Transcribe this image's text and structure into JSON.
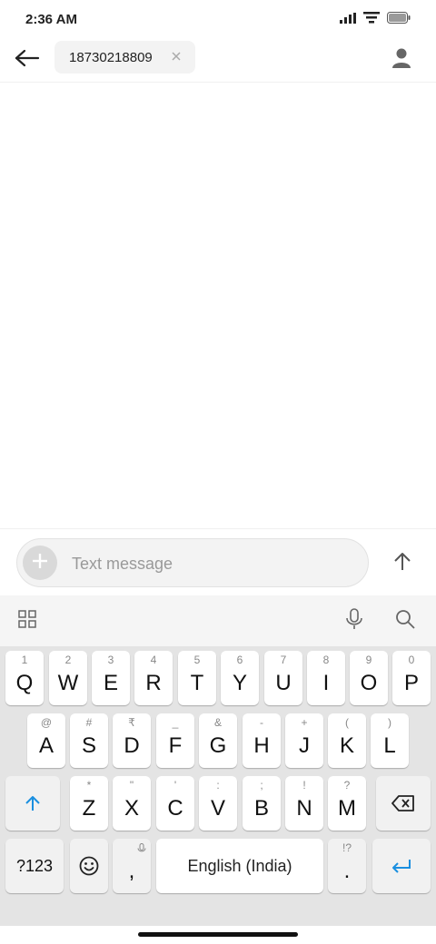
{
  "status_bar": {
    "time": "2:36 AM",
    "icons": [
      "signal-icon",
      "wifi-icon",
      "battery-icon"
    ]
  },
  "header": {
    "recipient": "18730218809",
    "back_icon": "arrow-left-icon",
    "contact_icon": "person-icon"
  },
  "compose": {
    "placeholder": "Text message",
    "add_icon": "plus-icon",
    "send_icon": "arrow-up-icon"
  },
  "keyboard": {
    "toolbar": {
      "left": "grid-icon",
      "right": [
        "mic-icon",
        "search-icon"
      ]
    },
    "row1": [
      {
        "key": "Q",
        "hint": "1"
      },
      {
        "key": "W",
        "hint": "2"
      },
      {
        "key": "E",
        "hint": "3"
      },
      {
        "key": "R",
        "hint": "4"
      },
      {
        "key": "T",
        "hint": "5"
      },
      {
        "key": "Y",
        "hint": "6"
      },
      {
        "key": "U",
        "hint": "7"
      },
      {
        "key": "I",
        "hint": "8"
      },
      {
        "key": "O",
        "hint": "9"
      },
      {
        "key": "P",
        "hint": "0"
      }
    ],
    "row2": [
      {
        "key": "A",
        "hint": "@"
      },
      {
        "key": "S",
        "hint": "#"
      },
      {
        "key": "D",
        "hint": "₹"
      },
      {
        "key": "F",
        "hint": "_"
      },
      {
        "key": "G",
        "hint": "&"
      },
      {
        "key": "H",
        "hint": "-"
      },
      {
        "key": "J",
        "hint": "+"
      },
      {
        "key": "K",
        "hint": "("
      },
      {
        "key": "L",
        "hint": ")"
      }
    ],
    "row3": [
      {
        "key": "Z",
        "hint": "*"
      },
      {
        "key": "X",
        "hint": "\""
      },
      {
        "key": "C",
        "hint": "'"
      },
      {
        "key": "V",
        "hint": ":"
      },
      {
        "key": "B",
        "hint": ";"
      },
      {
        "key": "N",
        "hint": "!"
      },
      {
        "key": "M",
        "hint": "?"
      }
    ],
    "symbols_label": "?123",
    "comma": {
      "key": ",",
      "hint_icon": "mic-icon"
    },
    "space_label": "English (India)",
    "period": {
      "key": ".",
      "hint": "!?"
    },
    "shift_icon": "shift-arrow-icon",
    "backspace_icon": "backspace-icon",
    "emoji_icon": "emoji-icon",
    "enter_icon": "enter-icon"
  },
  "colors": {
    "accent": "#1a8fe0",
    "keyboard_bg": "#e4e4e4",
    "key_bg": "#ffffff"
  }
}
